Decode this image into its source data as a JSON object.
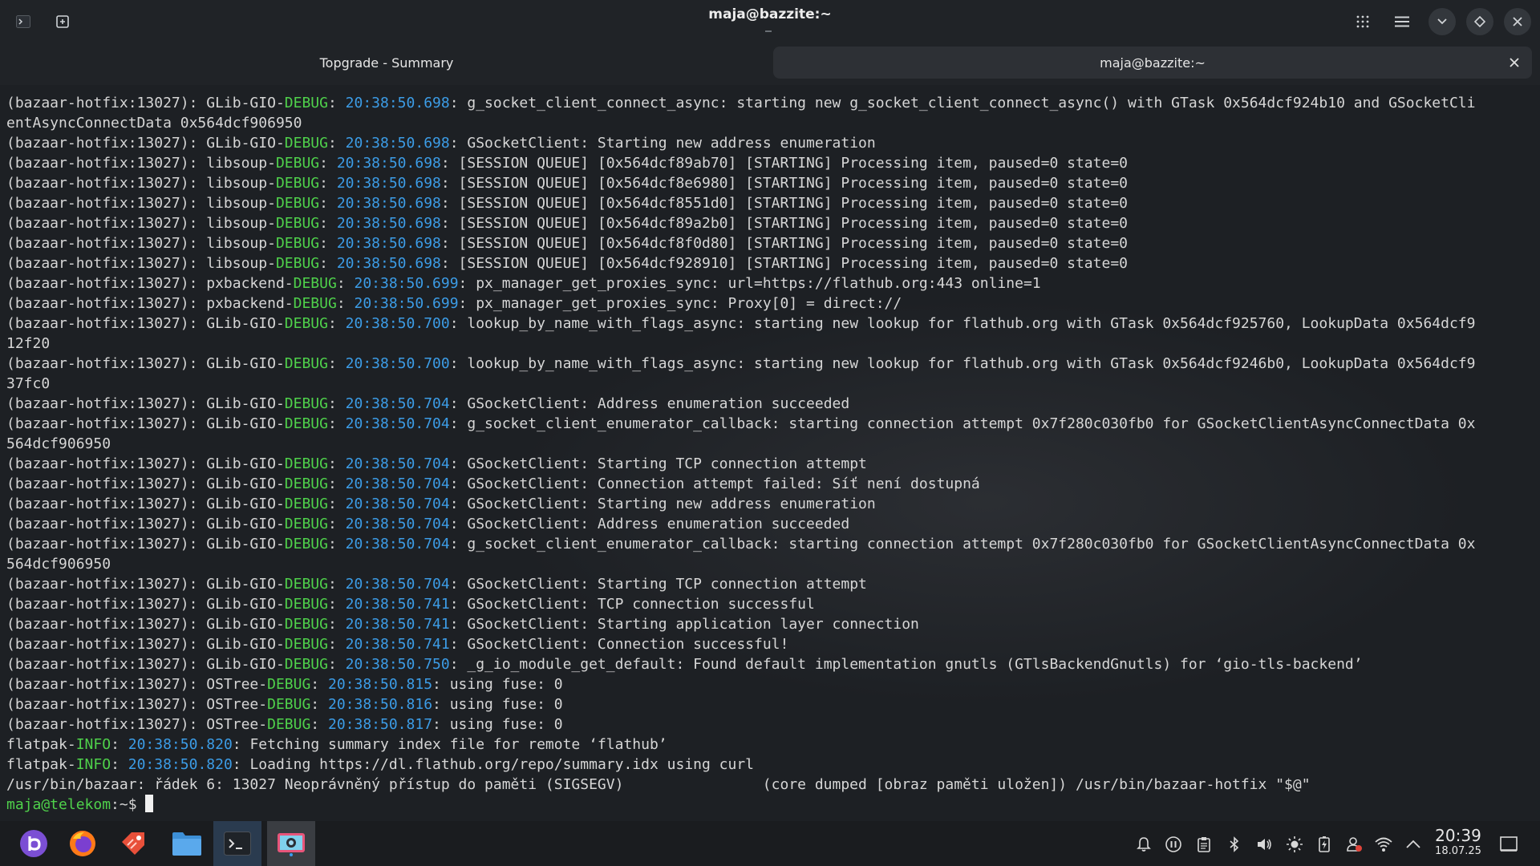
{
  "window": {
    "title": "maja@bazzite:~"
  },
  "tabs": [
    {
      "label": "Topgrade - Summary"
    },
    {
      "label": "maja@bazzite:~"
    }
  ],
  "terminal": {
    "lines": [
      "(bazaar-hotfix:13027): GLib-GIO-DEBUG: 20:38:50.698: g_socket_client_connect_async: starting new g_socket_client_connect_async() with GTask 0x564dcf924b10 and GSocketCli",
      "entAsyncConnectData 0x564dcf906950",
      "(bazaar-hotfix:13027): GLib-GIO-DEBUG: 20:38:50.698: GSocketClient: Starting new address enumeration",
      "(bazaar-hotfix:13027): libsoup-DEBUG: 20:38:50.698: [SESSION QUEUE] [0x564dcf89ab70] [STARTING] Processing item, paused=0 state=0",
      "(bazaar-hotfix:13027): libsoup-DEBUG: 20:38:50.698: [SESSION QUEUE] [0x564dcf8e6980] [STARTING] Processing item, paused=0 state=0",
      "(bazaar-hotfix:13027): libsoup-DEBUG: 20:38:50.698: [SESSION QUEUE] [0x564dcf8551d0] [STARTING] Processing item, paused=0 state=0",
      "(bazaar-hotfix:13027): libsoup-DEBUG: 20:38:50.698: [SESSION QUEUE] [0x564dcf89a2b0] [STARTING] Processing item, paused=0 state=0",
      "(bazaar-hotfix:13027): libsoup-DEBUG: 20:38:50.698: [SESSION QUEUE] [0x564dcf8f0d80] [STARTING] Processing item, paused=0 state=0",
      "(bazaar-hotfix:13027): libsoup-DEBUG: 20:38:50.698: [SESSION QUEUE] [0x564dcf928910] [STARTING] Processing item, paused=0 state=0",
      "(bazaar-hotfix:13027): pxbackend-DEBUG: 20:38:50.699: px_manager_get_proxies_sync: url=https://flathub.org:443 online=1",
      "(bazaar-hotfix:13027): pxbackend-DEBUG: 20:38:50.699: px_manager_get_proxies_sync: Proxy[0] = direct://",
      "(bazaar-hotfix:13027): GLib-GIO-DEBUG: 20:38:50.700: lookup_by_name_with_flags_async: starting new lookup for flathub.org with GTask 0x564dcf925760, LookupData 0x564dcf9",
      "12f20",
      "(bazaar-hotfix:13027): GLib-GIO-DEBUG: 20:38:50.700: lookup_by_name_with_flags_async: starting new lookup for flathub.org with GTask 0x564dcf9246b0, LookupData 0x564dcf9",
      "37fc0",
      "(bazaar-hotfix:13027): GLib-GIO-DEBUG: 20:38:50.704: GSocketClient: Address enumeration succeeded",
      "(bazaar-hotfix:13027): GLib-GIO-DEBUG: 20:38:50.704: g_socket_client_enumerator_callback: starting connection attempt 0x7f280c030fb0 for GSocketClientAsyncConnectData 0x",
      "564dcf906950",
      "(bazaar-hotfix:13027): GLib-GIO-DEBUG: 20:38:50.704: GSocketClient: Starting TCP connection attempt",
      "(bazaar-hotfix:13027): GLib-GIO-DEBUG: 20:38:50.704: GSocketClient: Connection attempt failed: Síť není dostupná",
      "(bazaar-hotfix:13027): GLib-GIO-DEBUG: 20:38:50.704: GSocketClient: Starting new address enumeration",
      "(bazaar-hotfix:13027): GLib-GIO-DEBUG: 20:38:50.704: GSocketClient: Address enumeration succeeded",
      "(bazaar-hotfix:13027): GLib-GIO-DEBUG: 20:38:50.704: g_socket_client_enumerator_callback: starting connection attempt 0x7f280c030fb0 for GSocketClientAsyncConnectData 0x",
      "564dcf906950",
      "(bazaar-hotfix:13027): GLib-GIO-DEBUG: 20:38:50.704: GSocketClient: Starting TCP connection attempt",
      "(bazaar-hotfix:13027): GLib-GIO-DEBUG: 20:38:50.741: GSocketClient: TCP connection successful",
      "(bazaar-hotfix:13027): GLib-GIO-DEBUG: 20:38:50.741: GSocketClient: Starting application layer connection",
      "(bazaar-hotfix:13027): GLib-GIO-DEBUG: 20:38:50.741: GSocketClient: Connection successful!",
      "(bazaar-hotfix:13027): GLib-GIO-DEBUG: 20:38:50.750: _g_io_module_get_default: Found default implementation gnutls (GTlsBackendGnutls) for ‘gio-tls-backend’",
      "(bazaar-hotfix:13027): OSTree-DEBUG: 20:38:50.815: using fuse: 0",
      "(bazaar-hotfix:13027): OSTree-DEBUG: 20:38:50.816: using fuse: 0",
      "(bazaar-hotfix:13027): OSTree-DEBUG: 20:38:50.817: using fuse: 0",
      "flatpak-INFO: 20:38:50.820: Fetching summary index file for remote ‘flathub’",
      "flatpak-INFO: 20:38:50.820: Loading https://dl.flathub.org/repo/summary.idx using curl",
      "/usr/bin/bazaar: řádek 6: 13027 Neoprávněný přístup do paměti (SIGSEGV)                (core dumped [obraz paměti uložen]) /usr/bin/bazaar-hotfix \"$@\""
    ],
    "prompt_user": "maja@telekom",
    "prompt_path": ":~$ "
  },
  "taskbar": {
    "clock_time": "20:39",
    "clock_date": "18.07.25"
  }
}
